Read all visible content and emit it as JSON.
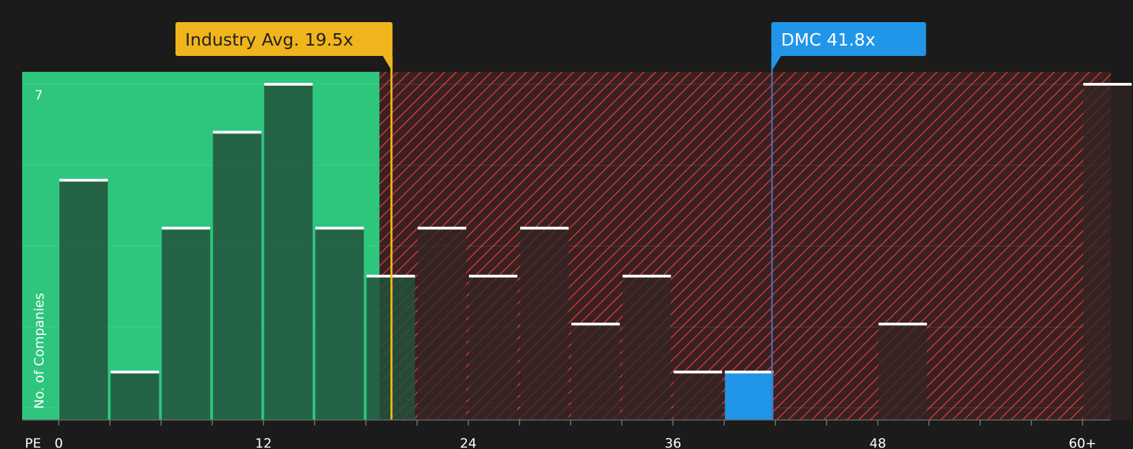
{
  "chart_data": {
    "type": "bar",
    "title": "",
    "xlabel": "PE",
    "ylabel": "No. of Companies",
    "x_ticks": [
      "0",
      "12",
      "24",
      "36",
      "48",
      "60+"
    ],
    "y_tick_labels": [
      "7"
    ],
    "ylim": [
      0,
      7
    ],
    "bin_width": 3,
    "bins": [
      {
        "start": 0,
        "end": 3,
        "count": 5
      },
      {
        "start": 3,
        "end": 6,
        "count": 1
      },
      {
        "start": 6,
        "end": 9,
        "count": 4
      },
      {
        "start": 9,
        "end": 12,
        "count": 6
      },
      {
        "start": 12,
        "end": 15,
        "count": 7
      },
      {
        "start": 15,
        "end": 18,
        "count": 4
      },
      {
        "start": 18,
        "end": 21,
        "count": 3
      },
      {
        "start": 21,
        "end": 24,
        "count": 4
      },
      {
        "start": 24,
        "end": 27,
        "count": 3
      },
      {
        "start": 27,
        "end": 30,
        "count": 4
      },
      {
        "start": 30,
        "end": 33,
        "count": 2
      },
      {
        "start": 33,
        "end": 36,
        "count": 3
      },
      {
        "start": 36,
        "end": 39,
        "count": 1
      },
      {
        "start": 39,
        "end": 42,
        "count": 1,
        "highlight": true
      },
      {
        "start": 42,
        "end": 45,
        "count": 0
      },
      {
        "start": 45,
        "end": 48,
        "count": 0
      },
      {
        "start": 48,
        "end": 51,
        "count": 2
      },
      {
        "start": 51,
        "end": 54,
        "count": 0
      },
      {
        "start": 54,
        "end": 57,
        "count": 0
      },
      {
        "start": 57,
        "end": 60,
        "count": 0
      },
      {
        "start": 60,
        "end": 63,
        "count": 7
      }
    ],
    "fair_zone_end": 18.8,
    "industry_avg": {
      "label": "Industry Avg. 19.5x",
      "value": 19.5
    },
    "company": {
      "label": "DMC 41.8x",
      "value": 41.8
    },
    "colors": {
      "background": "#1b1b1b",
      "green_zone": "#2ec67d",
      "red_zone": "#3a2020",
      "hatch": "#d03a3a",
      "bar_green": "#22513c",
      "bar_red": "#332424",
      "highlight": "#2196e8",
      "industry_line": "#f0b41c",
      "company_line": "#4a7ab8",
      "bar_cap": "#ffffff"
    }
  }
}
